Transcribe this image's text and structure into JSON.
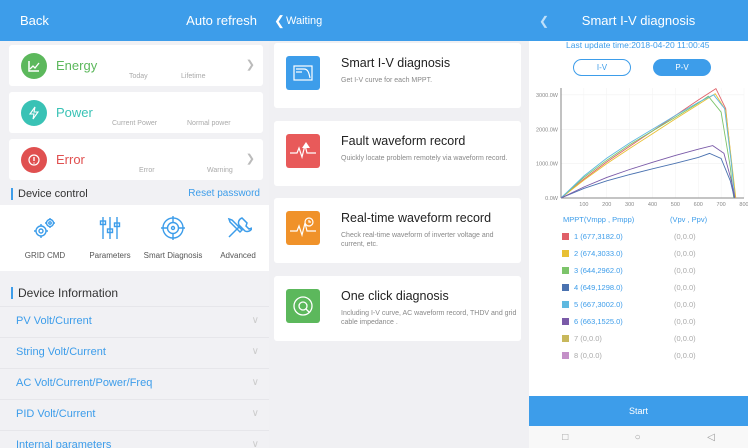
{
  "screen1": {
    "header": {
      "back": "Back",
      "refresh": "Auto refresh"
    },
    "monitors": [
      {
        "label": "Energy",
        "sub1": "Today",
        "sub2": "Lifetime",
        "color": "#5cb85c",
        "icon": "energy-chart-icon"
      },
      {
        "label": "Power",
        "sub1": "Current Power",
        "sub2": "Normal power",
        "color": "#39c2b5",
        "icon": "lightning-icon"
      },
      {
        "label": "Error",
        "sub1": "Error",
        "sub2": "Warning",
        "color": "#e05050",
        "icon": "error-shield-icon"
      }
    ],
    "device_control": {
      "title": "Device control",
      "reset": "Reset password",
      "items": [
        "GRID CMD",
        "Parameters",
        "Smart Diagnosis",
        "Advanced"
      ]
    },
    "device_info": {
      "title": "Device Information",
      "items": [
        "PV Volt/Current",
        "String Volt/Current",
        "AC Volt/Current/Power/Freq",
        "PID Volt/Current",
        "Internal parameters"
      ]
    }
  },
  "screen2": {
    "header": {
      "back": "Waiting"
    },
    "items": [
      {
        "title": "Smart I-V diagnosis",
        "desc": "Get I-V curve for each MPPT.",
        "color": "#3d9dea",
        "icon": "iv-curve-icon"
      },
      {
        "title": "Fault waveform record",
        "desc": "Quickly locate problem remotely via waveform record.",
        "color": "#e85a5a",
        "icon": "fault-wave-icon"
      },
      {
        "title": "Real-time waveform record",
        "desc": "Check real-time waveform of inverter voltage and current, etc.",
        "color": "#f0922a",
        "icon": "realtime-wave-icon"
      },
      {
        "title": "One click diagnosis",
        "desc": "Including I-V curve, AC waveform record, THDV and grid cable impedance .",
        "color": "#5cb85c",
        "icon": "one-click-icon"
      }
    ]
  },
  "screen3": {
    "header": {
      "title": "Smart I-V diagnosis"
    },
    "update": "Last update time:2018-04-20 11:00:45",
    "toggle": {
      "iv": "I-V",
      "pv": "P-V",
      "active": "P-V"
    },
    "legend_header": {
      "left": "MPPT(Vmpp , Pmpp)",
      "right": "(Vpv , Ppv)"
    },
    "legend": [
      {
        "num": "1",
        "val": "(677,3182.0)",
        "pv": "(0,0.0)",
        "color": "#e06068",
        "active": true
      },
      {
        "num": "2",
        "val": "(674,3033.0)",
        "pv": "(0,0.0)",
        "color": "#e8c034",
        "active": true
      },
      {
        "num": "3",
        "val": "(644,2962.0)",
        "pv": "(0,0.0)",
        "color": "#7cc46a",
        "active": true
      },
      {
        "num": "4",
        "val": "(649,1298.0)",
        "pv": "(0,0.0)",
        "color": "#4a72b0",
        "active": true
      },
      {
        "num": "5",
        "val": "(667,3002.0)",
        "pv": "(0,0.0)",
        "color": "#5fb9e0",
        "active": true
      },
      {
        "num": "6",
        "val": "(663,1525.0)",
        "pv": "(0,0.0)",
        "color": "#7a5aa8",
        "active": true
      },
      {
        "num": "7",
        "val": "(0,0.0)",
        "pv": "(0,0.0)",
        "color": "#c8b85c",
        "active": false
      },
      {
        "num": "8",
        "val": "(0,0.0)",
        "pv": "(0,0.0)",
        "color": "#c490c8",
        "active": false
      }
    ],
    "start": "Start",
    "nav": [
      "square-nav-icon",
      "circle-nav-icon",
      "triangle-back-icon"
    ]
  },
  "chart_data": {
    "type": "line",
    "title": "",
    "xlabel": "",
    "ylabel": "",
    "xlim": [
      0,
      800
    ],
    "ylim": [
      0,
      3200
    ],
    "x_ticks": [
      "100",
      "200",
      "300",
      "400",
      "500",
      "600",
      "700",
      "800"
    ],
    "y_ticks": [
      "0.0W",
      "1000.0W",
      "2000.0W",
      "3000.0W"
    ],
    "series": [
      {
        "name": "1",
        "color": "#e06068",
        "points": [
          [
            0,
            0
          ],
          [
            100,
            550
          ],
          [
            200,
            1050
          ],
          [
            300,
            1500
          ],
          [
            400,
            1950
          ],
          [
            500,
            2400
          ],
          [
            600,
            2850
          ],
          [
            677,
            3182
          ],
          [
            720,
            2600
          ],
          [
            750,
            700
          ],
          [
            762,
            0
          ]
        ]
      },
      {
        "name": "2",
        "color": "#e8c034",
        "points": [
          [
            0,
            0
          ],
          [
            100,
            520
          ],
          [
            200,
            1000
          ],
          [
            300,
            1440
          ],
          [
            400,
            1870
          ],
          [
            500,
            2300
          ],
          [
            600,
            2720
          ],
          [
            674,
            3033
          ],
          [
            720,
            2550
          ],
          [
            750,
            800
          ],
          [
            764,
            0
          ]
        ]
      },
      {
        "name": "3",
        "color": "#7cc46a",
        "points": [
          [
            0,
            0
          ],
          [
            100,
            600
          ],
          [
            200,
            1100
          ],
          [
            300,
            1550
          ],
          [
            400,
            1950
          ],
          [
            500,
            2350
          ],
          [
            600,
            2760
          ],
          [
            644,
            2962
          ],
          [
            700,
            2500
          ],
          [
            740,
            900
          ],
          [
            755,
            0
          ]
        ]
      },
      {
        "name": "4",
        "color": "#4a72b0",
        "points": [
          [
            0,
            0
          ],
          [
            100,
            280
          ],
          [
            200,
            500
          ],
          [
            300,
            680
          ],
          [
            400,
            850
          ],
          [
            500,
            1010
          ],
          [
            600,
            1180
          ],
          [
            649,
            1298
          ],
          [
            700,
            1150
          ],
          [
            740,
            500
          ],
          [
            758,
            0
          ]
        ]
      },
      {
        "name": "5",
        "color": "#5fb9e0",
        "points": [
          [
            0,
            0
          ],
          [
            100,
            640
          ],
          [
            200,
            1160
          ],
          [
            300,
            1600
          ],
          [
            400,
            2000
          ],
          [
            500,
            2400
          ],
          [
            600,
            2780
          ],
          [
            667,
            3002
          ],
          [
            715,
            2600
          ],
          [
            745,
            1000
          ],
          [
            760,
            0
          ]
        ]
      },
      {
        "name": "6",
        "color": "#7a5aa8",
        "points": [
          [
            0,
            0
          ],
          [
            100,
            320
          ],
          [
            200,
            600
          ],
          [
            300,
            830
          ],
          [
            400,
            1040
          ],
          [
            500,
            1240
          ],
          [
            600,
            1420
          ],
          [
            663,
            1525
          ],
          [
            712,
            1300
          ],
          [
            745,
            500
          ],
          [
            760,
            0
          ]
        ]
      }
    ]
  }
}
